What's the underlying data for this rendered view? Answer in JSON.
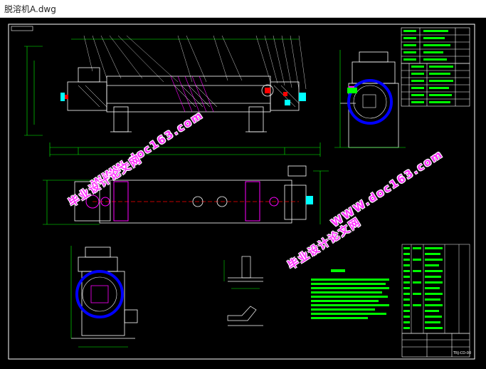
{
  "window": {
    "title": "脱溶机A.dwg"
  },
  "watermarks": {
    "cn_text": "毕业设计论文网",
    "url_text": "WWW.doc163.com"
  },
  "drawing": {
    "title_block_code": "TRJ-CD-00"
  },
  "colors": {
    "background": "#000000",
    "frame": "#ffffff",
    "geometry": "#ffffff",
    "dimension": "#00ff00",
    "hatch": "#ff00ff",
    "accent": "#ff0000",
    "watermark": "#ff33ff"
  }
}
